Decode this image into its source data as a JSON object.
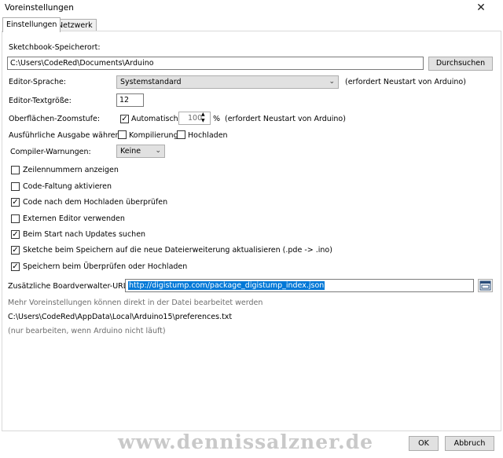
{
  "window": {
    "title": "Voreinstellungen",
    "close_glyph": "✕"
  },
  "tabs": [
    {
      "label": "Einstellungen",
      "active": true
    },
    {
      "label": "Netzwerk",
      "active": false
    }
  ],
  "sketchbook": {
    "label": "Sketchbook-Speicherort:",
    "value": "C:\\Users\\CodeRed\\Documents\\Arduino",
    "browse_label": "Durchsuchen"
  },
  "editor_language": {
    "label": "Editor-Sprache:",
    "value": "Systemstandard",
    "note": "(erfordert Neustart von Arduino)"
  },
  "editor_font_size": {
    "label": "Editor-Textgröße:",
    "value": "12"
  },
  "zoom": {
    "label": "Oberflächen-Zoomstufe:",
    "auto_label": "Automatisch",
    "auto_checked": true,
    "value": "100",
    "unit": "%",
    "note": "(erfordert Neustart von Arduino)"
  },
  "verbose": {
    "label": "Ausführliche Ausgabe während:",
    "compile_label": "Kompilierung",
    "compile_checked": false,
    "upload_label": "Hochladen",
    "upload_checked": false
  },
  "compiler_warnings": {
    "label": "Compiler-Warnungen:",
    "value": "Keine"
  },
  "options": [
    {
      "label": "Zeilennummern anzeigen",
      "checked": false
    },
    {
      "label": "Code-Faltung aktivieren",
      "checked": false
    },
    {
      "label": "Code nach dem Hochladen überprüfen",
      "checked": true
    },
    {
      "label": "Externen Editor verwenden",
      "checked": false
    },
    {
      "label": "Beim Start nach Updates suchen",
      "checked": true
    },
    {
      "label": "Sketche beim Speichern auf die neue Dateierweiterung aktualisieren (.pde -> .ino)",
      "checked": true
    },
    {
      "label": "Speichern beim Überprüfen oder Hochladen",
      "checked": true
    }
  ],
  "board_urls": {
    "label": "Zusätzliche Boardverwalter-URLs:",
    "value": "http://digistump.com/package_digistump_index.json"
  },
  "info": {
    "line1": "Mehr Voreinstellungen können direkt in der Datei bearbeitet werden",
    "path": "C:\\Users\\CodeRed\\AppData\\Local\\Arduino15\\preferences.txt",
    "line3": "(nur bearbeiten, wenn Arduino nicht läuft)"
  },
  "watermark": "www.dennissalzner.de",
  "buttons": {
    "ok": "OK",
    "cancel": "Abbruch"
  },
  "checkmark_glyph": "✓"
}
